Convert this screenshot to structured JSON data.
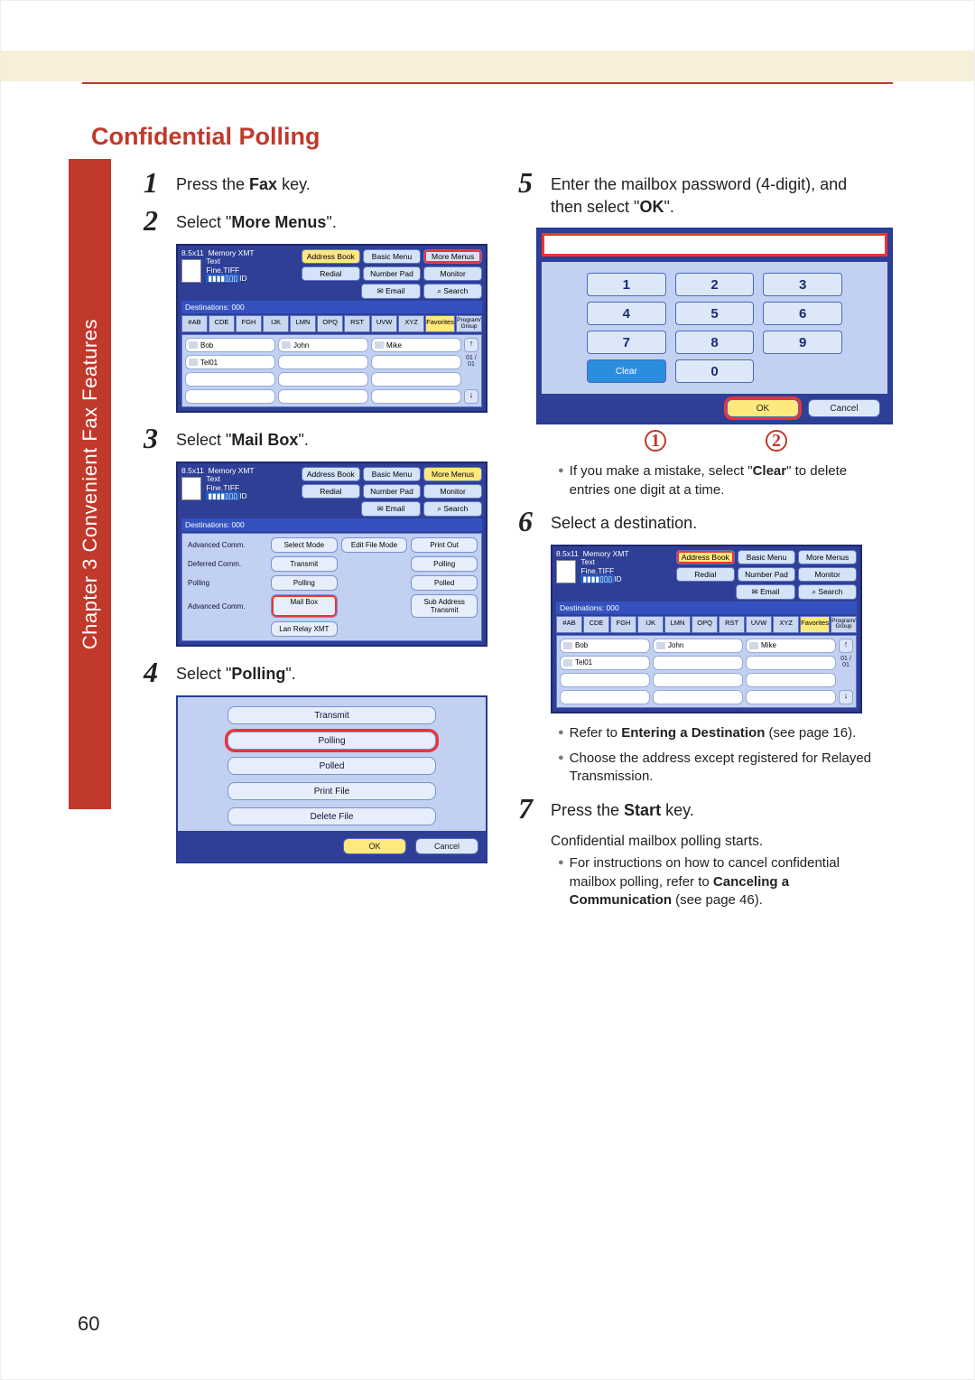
{
  "chapter_tab": "Chapter 3    Convenient Fax Features",
  "title": "Confidential Polling",
  "page_number": "60",
  "steps": {
    "s1": {
      "num": "1",
      "pre": "Press the ",
      "bold": "Fax",
      "post": " key."
    },
    "s2": {
      "num": "2",
      "pre": "Select \"",
      "bold": "More Menus",
      "post": "\"."
    },
    "s3": {
      "num": "3",
      "pre": "Select \"",
      "bold": "Mail Box",
      "post": "\"."
    },
    "s4": {
      "num": "4",
      "pre": "Select \"",
      "bold": "Polling",
      "post": "\"."
    },
    "s5": {
      "num": "5",
      "pre": "Enter the mailbox password (4-digit), and then select \"",
      "bold": "OK",
      "post": "\"."
    },
    "s6": {
      "num": "6",
      "text": "Select a destination."
    },
    "s7": {
      "num": "7",
      "pre": "Press the ",
      "bold": "Start",
      "post": " key."
    }
  },
  "ui1": {
    "size": "8.5x11",
    "mem": "Memory XMT",
    "qual1": "Text",
    "qual2": "Fine.TIFF",
    "id_suffix": "ID",
    "dest": "Destinations: 000",
    "addr_book": "Address Book",
    "basic_menu": "Basic Menu",
    "more_menus": "More Menus",
    "redial": "Redial",
    "number_pad": "Number Pad",
    "monitor": "Monitor",
    "email": "Email",
    "search": "Search",
    "tabs": [
      "#AB",
      "CDE",
      "FGH",
      "IJK",
      "LMN",
      "OPQ",
      "RST",
      "UVW",
      "XYZ"
    ],
    "favorites": "Favorites",
    "program": "Program/\nGroup",
    "contacts_row1": [
      "Bob",
      "John",
      "Mike"
    ],
    "contacts_row2": [
      "Tel01"
    ],
    "scroll_ind": "01\n/\n01"
  },
  "ui2": {
    "rows": [
      {
        "label": "Advanced Comm.",
        "btns": [
          "Select Mode",
          "Edit File Mode",
          "Print Out"
        ],
        "hl": -1
      },
      {
        "label": "Deferred Comm.",
        "btns": [
          "Transmit",
          "",
          "Polling"
        ],
        "hl": -1
      },
      {
        "label": "Polling",
        "btns": [
          "Polling",
          "",
          "Polled"
        ],
        "hl": -1
      },
      {
        "label": "Advanced Comm.",
        "btns": [
          "Mail Box",
          "",
          "Sub Address Transmit"
        ],
        "hl": 0
      },
      {
        "label": "",
        "btns": [
          "Lan Relay XMT",
          "",
          ""
        ],
        "hl": -1
      }
    ]
  },
  "ui3": {
    "items": [
      "Transmit",
      "Polling",
      "Polled",
      "Print File",
      "Delete File"
    ],
    "highlight_index": 1,
    "ok": "OK",
    "cancel": "Cancel"
  },
  "keypad": {
    "keys": [
      "1",
      "2",
      "3",
      "4",
      "5",
      "6",
      "7",
      "8",
      "9",
      "Clear",
      "0",
      ""
    ],
    "ok": "OK",
    "cancel": "Cancel"
  },
  "callouts": {
    "c1": "1",
    "c2": "2"
  },
  "note5": {
    "pre": "If you make a mistake, select \"",
    "bold": "Clear",
    "post": "\" to delete entries one digit at a time."
  },
  "note6a": {
    "pre": "Refer to ",
    "bold": "Entering a Destination",
    "post": " (see page 16)."
  },
  "note6b": "Choose the address except registered for Relayed Transmission.",
  "sub7": "Confidential mailbox polling starts.",
  "note7": {
    "pre": "For instructions on how to cancel confidential mailbox polling, refer to ",
    "bold": "Canceling a Communication",
    "post": " (see page 46)."
  }
}
